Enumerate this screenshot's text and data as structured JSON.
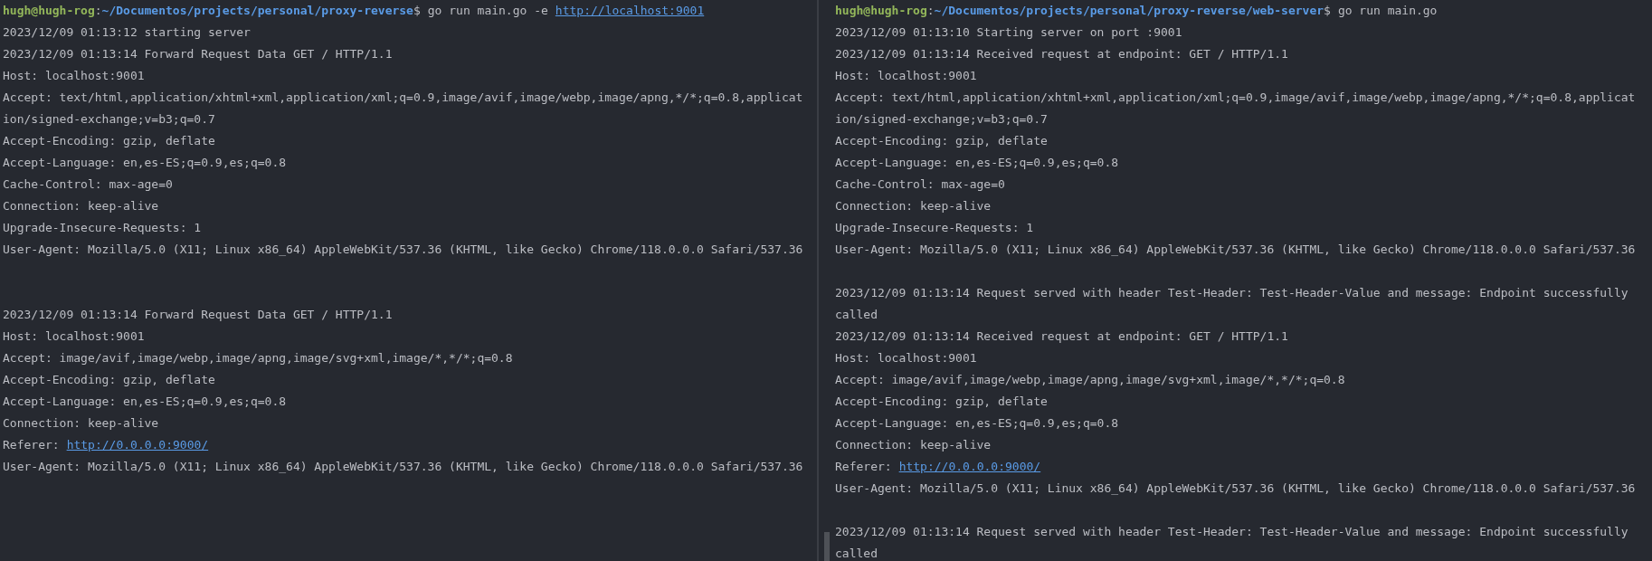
{
  "panes": [
    {
      "prompt": {
        "user": "hugh@hugh-rog",
        "separator": ":",
        "path": "~/Documentos/projects/personal/proxy-reverse",
        "symbol": "$",
        "command": "go run main.go -e",
        "link": "http://localhost:9001"
      },
      "lines": [
        {
          "kind": "text",
          "text": "2023/12/09 01:13:12 starting server"
        },
        {
          "kind": "text",
          "text": "2023/12/09 01:13:14 Forward Request Data GET / HTTP/1.1"
        },
        {
          "kind": "text",
          "text": "Host: localhost:9001"
        },
        {
          "kind": "text",
          "text": "Accept: text/html,application/xhtml+xml,application/xml;q=0.9,image/avif,image/webp,image/apng,*/*;q=0.8,applicat"
        },
        {
          "kind": "text",
          "text": "ion/signed-exchange;v=b3;q=0.7"
        },
        {
          "kind": "text",
          "text": "Accept-Encoding: gzip, deflate"
        },
        {
          "kind": "text",
          "text": "Accept-Language: en,es-ES;q=0.9,es;q=0.8"
        },
        {
          "kind": "text",
          "text": "Cache-Control: max-age=0"
        },
        {
          "kind": "text",
          "text": "Connection: keep-alive"
        },
        {
          "kind": "text",
          "text": "Upgrade-Insecure-Requests: 1"
        },
        {
          "kind": "text",
          "text": "User-Agent: Mozilla/5.0 (X11; Linux x86_64) AppleWebKit/537.36 (KHTML, like Gecko) Chrome/118.0.0.0 Safari/537.36"
        },
        {
          "kind": "blank"
        },
        {
          "kind": "blank"
        },
        {
          "kind": "text",
          "text": "2023/12/09 01:13:14 Forward Request Data GET / HTTP/1.1"
        },
        {
          "kind": "text",
          "text": "Host: localhost:9001"
        },
        {
          "kind": "text",
          "text": "Accept: image/avif,image/webp,image/apng,image/svg+xml,image/*,*/*;q=0.8"
        },
        {
          "kind": "text",
          "text": "Accept-Encoding: gzip, deflate"
        },
        {
          "kind": "text",
          "text": "Accept-Language: en,es-ES;q=0.9,es;q=0.8"
        },
        {
          "kind": "text",
          "text": "Connection: keep-alive"
        },
        {
          "kind": "link",
          "text": "Referer:",
          "link": "http://0.0.0.0:9000/"
        },
        {
          "kind": "text",
          "text": "User-Agent: Mozilla/5.0 (X11; Linux x86_64) AppleWebKit/537.36 (KHTML, like Gecko) Chrome/118.0.0.0 Safari/537.36"
        }
      ]
    },
    {
      "prompt": {
        "user": "hugh@hugh-rog",
        "separator": ":",
        "path": "~/Documentos/projects/personal/proxy-reverse/web-server",
        "symbol": "$",
        "command": "go run main.go"
      },
      "lines": [
        {
          "kind": "text",
          "text": "2023/12/09 01:13:10 Starting server on port :9001"
        },
        {
          "kind": "text",
          "text": "2023/12/09 01:13:14 Received request at endpoint: GET / HTTP/1.1"
        },
        {
          "kind": "text",
          "text": "Host: localhost:9001"
        },
        {
          "kind": "text",
          "text": "Accept: text/html,application/xhtml+xml,application/xml;q=0.9,image/avif,image/webp,image/apng,*/*;q=0.8,applicat"
        },
        {
          "kind": "text",
          "text": "ion/signed-exchange;v=b3;q=0.7"
        },
        {
          "kind": "text",
          "text": "Accept-Encoding: gzip, deflate"
        },
        {
          "kind": "text",
          "text": "Accept-Language: en,es-ES;q=0.9,es;q=0.8"
        },
        {
          "kind": "text",
          "text": "Cache-Control: max-age=0"
        },
        {
          "kind": "text",
          "text": "Connection: keep-alive"
        },
        {
          "kind": "text",
          "text": "Upgrade-Insecure-Requests: 1"
        },
        {
          "kind": "text",
          "text": "User-Agent: Mozilla/5.0 (X11; Linux x86_64) AppleWebKit/537.36 (KHTML, like Gecko) Chrome/118.0.0.0 Safari/537.36"
        },
        {
          "kind": "blank"
        },
        {
          "kind": "text",
          "text": "2023/12/09 01:13:14 Request served with header Test-Header: Test-Header-Value and message: Endpoint successfully"
        },
        {
          "kind": "text",
          "text": "called"
        },
        {
          "kind": "text",
          "text": "2023/12/09 01:13:14 Received request at endpoint: GET / HTTP/1.1"
        },
        {
          "kind": "text",
          "text": "Host: localhost:9001"
        },
        {
          "kind": "text",
          "text": "Accept: image/avif,image/webp,image/apng,image/svg+xml,image/*,*/*;q=0.8"
        },
        {
          "kind": "text",
          "text": "Accept-Encoding: gzip, deflate"
        },
        {
          "kind": "text",
          "text": "Accept-Language: en,es-ES;q=0.9,es;q=0.8"
        },
        {
          "kind": "text",
          "text": "Connection: keep-alive"
        },
        {
          "kind": "link",
          "text": "Referer:",
          "link": "http://0.0.0.0:9000/"
        },
        {
          "kind": "text",
          "text": "User-Agent: Mozilla/5.0 (X11; Linux x86_64) AppleWebKit/537.36 (KHTML, like Gecko) Chrome/118.0.0.0 Safari/537.36"
        },
        {
          "kind": "blank"
        },
        {
          "kind": "text",
          "text": "2023/12/09 01:13:14 Request served with header Test-Header: Test-Header-Value and message: Endpoint successfully"
        },
        {
          "kind": "text",
          "text": "called"
        }
      ]
    }
  ]
}
